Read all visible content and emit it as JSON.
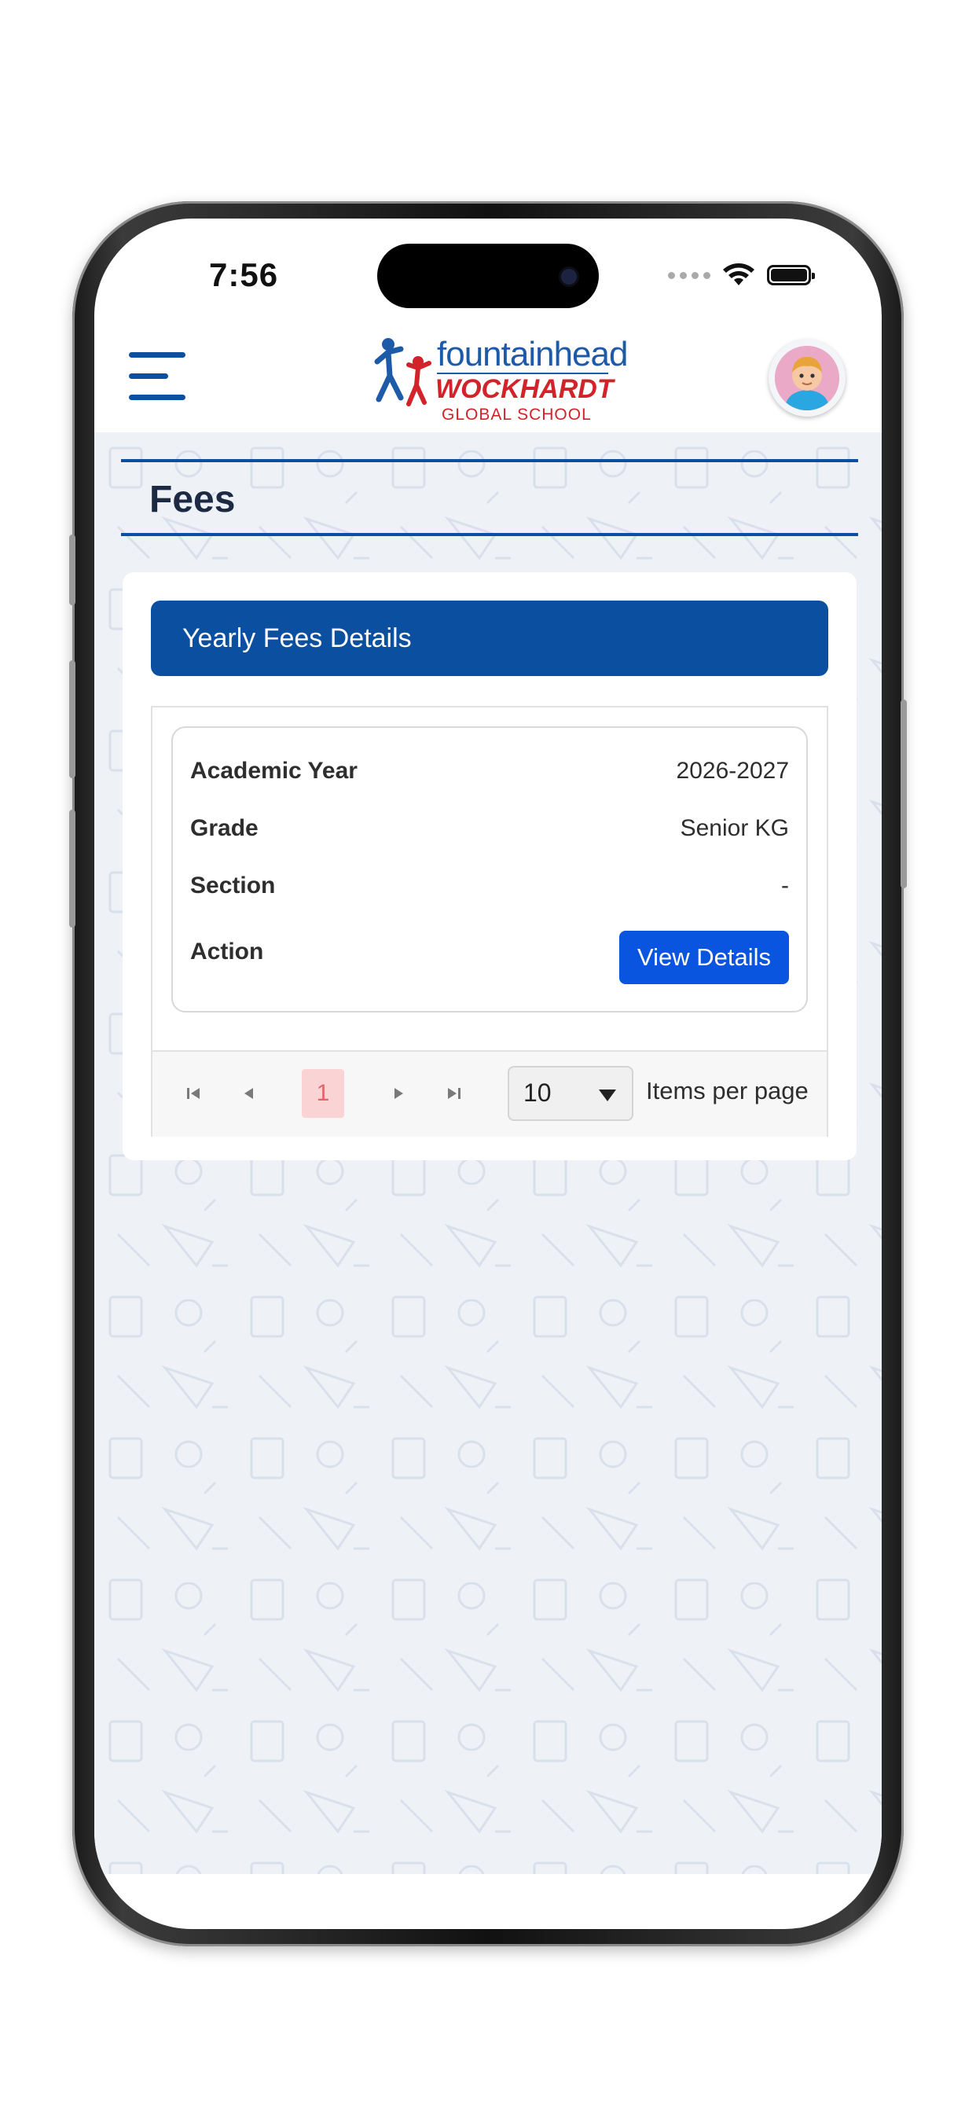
{
  "status_bar": {
    "time": "7:56"
  },
  "header": {
    "logo": {
      "line1": "fountainhead",
      "line2": "WOCKHARDT",
      "line3": "GLOBAL SCHOOL"
    }
  },
  "page": {
    "title": "Fees"
  },
  "section": {
    "title": "Yearly Fees Details"
  },
  "record": {
    "fields": [
      {
        "label": "Academic Year",
        "value": "2026-2027"
      },
      {
        "label": "Grade",
        "value": "Senior KG"
      },
      {
        "label": "Section",
        "value": "-"
      },
      {
        "label": "Action",
        "value": ""
      }
    ],
    "action_label": "View Details"
  },
  "pager": {
    "current_page": "1",
    "page_size": "10",
    "items_per_page_label": "Items per page"
  },
  "colors": {
    "brand_blue": "#0a4fa0",
    "button_blue": "#0a55e0",
    "page_highlight": "#fad4d4"
  }
}
